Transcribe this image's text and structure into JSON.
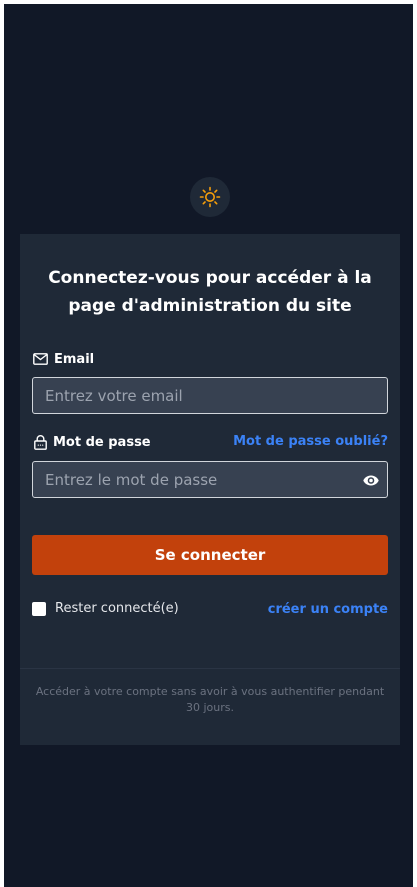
{
  "theme_toggle": {
    "icon": "sun-icon",
    "color": "#f59e0b"
  },
  "login": {
    "title": "Connectez-vous pour accéder à la page d'administration du site",
    "email": {
      "label": "Email",
      "icon": "mail-icon",
      "placeholder": "Entrez votre email",
      "value": ""
    },
    "password": {
      "label": "Mot de passe",
      "icon": "lock-icon",
      "placeholder": "Entrez le mot de passe",
      "value": "",
      "forgot_link": "Mot de passe oublié?",
      "visibility_icon": "eye-icon"
    },
    "submit_label": "Se connecter",
    "remember": {
      "label": "Rester connecté(e)",
      "checked": false
    },
    "create_account_link": "créer un compte",
    "footer_note": "Accéder à votre compte sans avoir à vous authentifier pendant 30 jours."
  },
  "colors": {
    "background": "#111827",
    "card": "#1f2937",
    "input": "#374151",
    "accent": "#c2410c",
    "link": "#3b82f6"
  }
}
